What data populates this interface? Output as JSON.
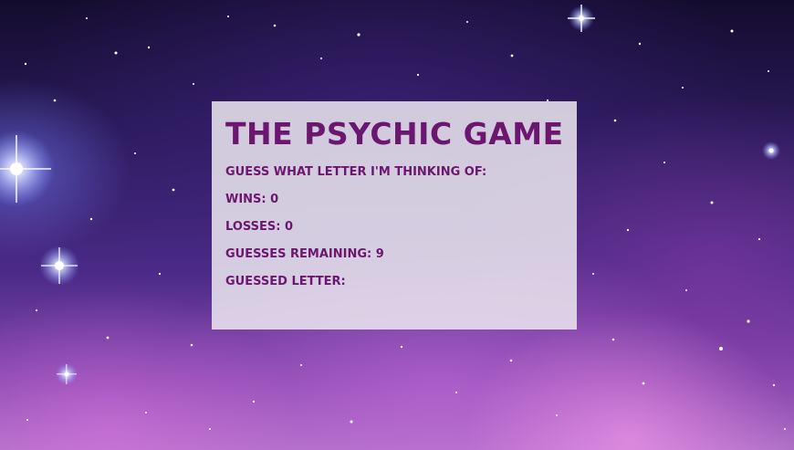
{
  "game": {
    "title": "The Psychic Game",
    "prompt": "Guess what letter I'm thinking of:",
    "wins_label": "Wins:",
    "wins": "0",
    "losses_label": "Losses:",
    "losses": "0",
    "guesses_remaining_label": "Guesses Remaining:",
    "guesses_remaining": "9",
    "guessed_label": "Guessed Letter:",
    "guessed_letters": ""
  },
  "colors": {
    "text": "#6c176f",
    "panel": "#ece8f0",
    "space_dark": "#140c2e",
    "space_purple": "#8a4ab0"
  }
}
